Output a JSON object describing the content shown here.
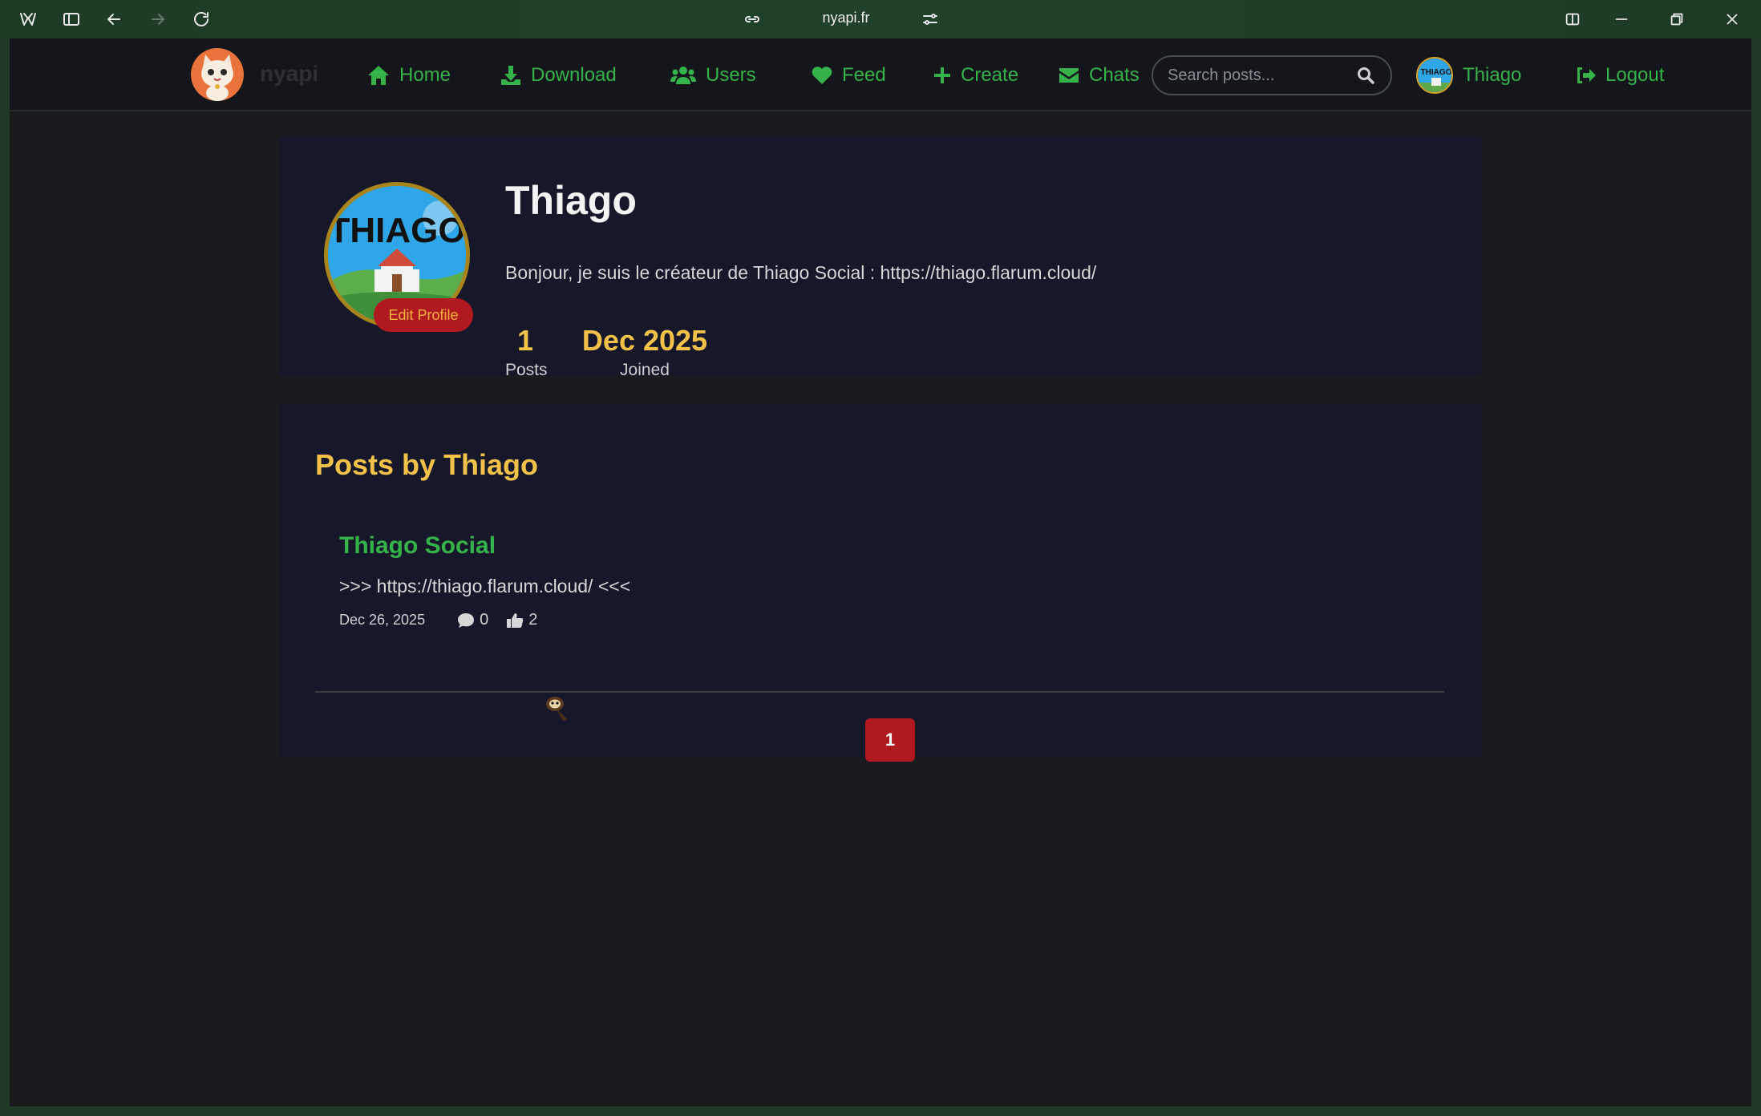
{
  "browser": {
    "url": "nyapi.fr"
  },
  "navbar": {
    "brand": "nyapi",
    "items": [
      {
        "label": "Home",
        "icon": "home-icon"
      },
      {
        "label": "Download",
        "icon": "download-icon"
      },
      {
        "label": "Users",
        "icon": "users-icon"
      },
      {
        "label": "Feed",
        "icon": "heart-icon"
      },
      {
        "label": "Create",
        "icon": "plus-icon"
      },
      {
        "label": "Chats",
        "icon": "envelope-icon"
      }
    ],
    "search_placeholder": "Search posts...",
    "user_name": "Thiago",
    "logout_label": "Logout",
    "accent_color": "#35b34a"
  },
  "profile": {
    "name": "Thiago",
    "avatar_text": "THIAGO",
    "bio": "Bonjour, je suis le créateur de Thiago Social : https://thiago.flarum.cloud/",
    "edit_label": "Edit Profile",
    "stats": {
      "posts_value": "1",
      "posts_label": "Posts",
      "joined_value": "Dec 2025",
      "joined_label": "Joined"
    }
  },
  "posts_section": {
    "title": "Posts by Thiago",
    "posts": [
      {
        "title": "Thiago Social",
        "body": ">>> https://thiago.flarum.cloud/ <<<",
        "date": "Dec 26, 2025",
        "comments": "0",
        "likes": "2"
      }
    ],
    "pagination": {
      "current_page": "1"
    }
  },
  "colors": {
    "gold": "#f2c14a",
    "red": "#b0191f",
    "card_bg": "#17172a",
    "page_bg": "#1a1b1e"
  }
}
